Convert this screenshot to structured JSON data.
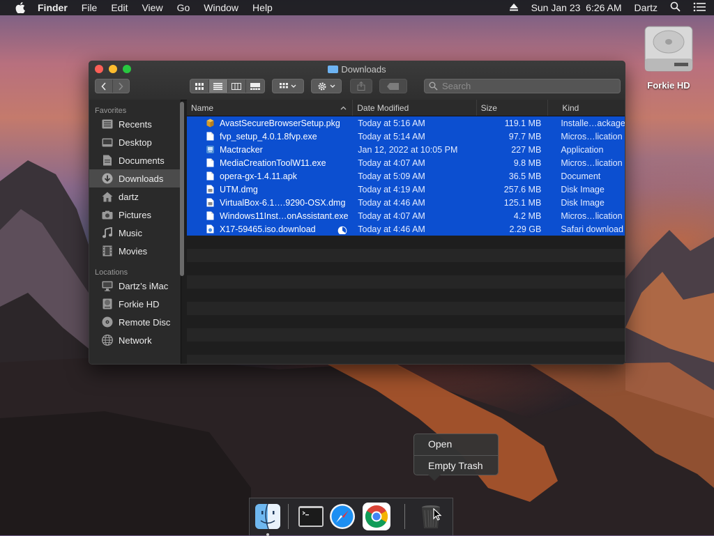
{
  "menubar": {
    "app": "Finder",
    "items": [
      "File",
      "Edit",
      "View",
      "Go",
      "Window",
      "Help"
    ],
    "clock": "Sun Jan 23  6:26 AM",
    "user": "Dartz",
    "icons": [
      "apple-icon",
      "eject-icon",
      "spotlight-icon",
      "notification-center-icon"
    ]
  },
  "desktop": {
    "disk_label": "Forkie HD"
  },
  "window": {
    "title": "Downloads",
    "search_placeholder": "Search",
    "sidebar": {
      "favorites_header": "Favorites",
      "favorites": [
        {
          "label": "Recents",
          "icon": "recents-icon"
        },
        {
          "label": "Desktop",
          "icon": "desktop-icon"
        },
        {
          "label": "Documents",
          "icon": "documents-icon"
        },
        {
          "label": "Downloads",
          "icon": "downloads-icon",
          "selected": true
        },
        {
          "label": "dartz",
          "icon": "home-icon"
        },
        {
          "label": "Pictures",
          "icon": "pictures-icon"
        },
        {
          "label": "Music",
          "icon": "music-icon"
        },
        {
          "label": "Movies",
          "icon": "movies-icon"
        }
      ],
      "locations_header": "Locations",
      "locations": [
        {
          "label": "Dartz’s iMac",
          "icon": "imac-icon"
        },
        {
          "label": "Forkie HD",
          "icon": "disk-icon"
        },
        {
          "label": "Remote Disc",
          "icon": "remote-disc-icon"
        },
        {
          "label": "Network",
          "icon": "network-icon"
        }
      ]
    },
    "columns": {
      "name": "Name",
      "date": "Date Modified",
      "size": "Size",
      "kind": "Kind"
    },
    "files": [
      {
        "name": "AvastSecureBrowserSetup.pkg",
        "date": "Today at 5:16 AM",
        "size": "119.1 MB",
        "kind": "Installe…ackage",
        "icon": "package-icon"
      },
      {
        "name": "fvp_setup_4.0.1.8fvp.exe",
        "date": "Today at 5:14 AM",
        "size": "97.7 MB",
        "kind": "Micros…lication",
        "icon": "document-icon"
      },
      {
        "name": "Mactracker",
        "date": "Jan 12, 2022 at 10:05 PM",
        "size": "227 MB",
        "kind": "Application",
        "icon": "application-icon"
      },
      {
        "name": "MediaCreationToolW11.exe",
        "date": "Today at 4:07 AM",
        "size": "9.8 MB",
        "kind": "Micros…lication",
        "icon": "document-icon"
      },
      {
        "name": "opera-gx-1.4.11.apk",
        "date": "Today at 5:09 AM",
        "size": "36.5 MB",
        "kind": "Document",
        "icon": "document-icon"
      },
      {
        "name": "UTM.dmg",
        "date": "Today at 4:19 AM",
        "size": "257.6 MB",
        "kind": "Disk Image",
        "icon": "disk-image-icon"
      },
      {
        "name": "VirtualBox-6.1….9290-OSX.dmg",
        "date": "Today at 4:46 AM",
        "size": "125.1 MB",
        "kind": "Disk Image",
        "icon": "disk-image-icon"
      },
      {
        "name": "Windows11Inst…onAssistant.exe",
        "date": "Today at 4:07 AM",
        "size": "4.2 MB",
        "kind": "Micros…lication",
        "icon": "document-icon"
      },
      {
        "name": "X17-59465.iso.download",
        "date": "Today at 4:46 AM",
        "size": "2.29 GB",
        "kind": "Safari download",
        "icon": "safari-download-icon",
        "progress": 0.35
      }
    ]
  },
  "context_menu": {
    "items": [
      "Open",
      "Empty Trash"
    ]
  },
  "dock": {
    "apps": [
      "finder-icon",
      "terminal-icon",
      "safari-icon",
      "chrome-icon",
      "trash-icon"
    ]
  }
}
